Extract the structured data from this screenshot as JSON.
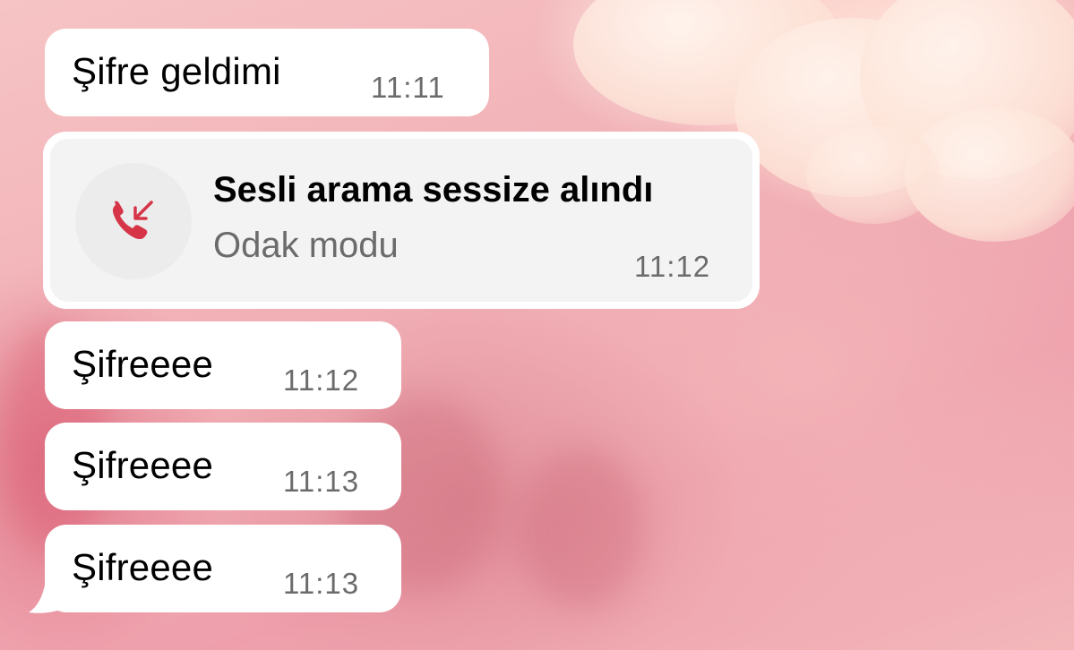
{
  "messages": [
    {
      "text": "Şifre geldimi",
      "time": "11:11"
    },
    {
      "text": "Şifreeee",
      "time": "11:12"
    },
    {
      "text": "Şifreeee",
      "time": "11:13"
    },
    {
      "text": "Şifreeee",
      "time": "11:13"
    }
  ],
  "call": {
    "title": "Sesli arama sessize alındı",
    "subtitle": "Odak modu",
    "time": "11:12",
    "icon": "missed-call-icon",
    "icon_color": "#d63447"
  },
  "colors": {
    "bubble": "#ffffff",
    "call_inner": "#f3f3f3",
    "timestamp": "#6b6b6b"
  }
}
